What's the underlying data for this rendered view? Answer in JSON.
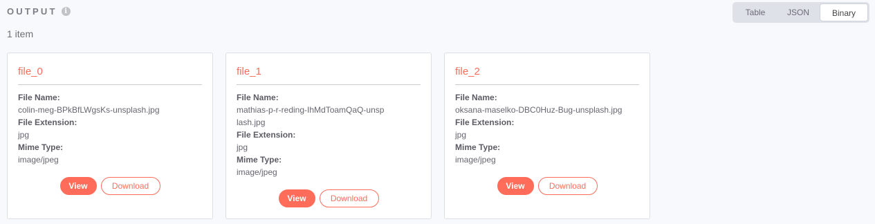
{
  "output": {
    "title": "OUTPUT",
    "info_icon": "info-icon",
    "count": "1 item"
  },
  "view_switch": {
    "options": [
      "Table",
      "JSON",
      "Binary"
    ],
    "selected": "Binary"
  },
  "field_labels": {
    "file_name": "File Name:",
    "file_extension": "File Extension:",
    "mime_type": "Mime Type:"
  },
  "buttons": {
    "view": "View",
    "download": "Download"
  },
  "files": [
    {
      "title": "file_0",
      "file_name": "colin-meg-BPkBfLWgsKs-unsplash.jpg",
      "file_extension": "jpg",
      "mime_type": "image/jpeg"
    },
    {
      "title": "file_1",
      "file_name": "mathias-p-r-reding-IhMdToamQaQ-unsplash.jpg",
      "file_extension": "jpg",
      "mime_type": "image/jpeg"
    },
    {
      "title": "file_2",
      "file_name": "oksana-maselko-DBC0Huz-Bug-unsplash.jpg",
      "file_extension": "jpg",
      "mime_type": "image/jpeg"
    }
  ],
  "colors": {
    "accent": "#ff6d5a",
    "background": "#f8f9fc"
  }
}
